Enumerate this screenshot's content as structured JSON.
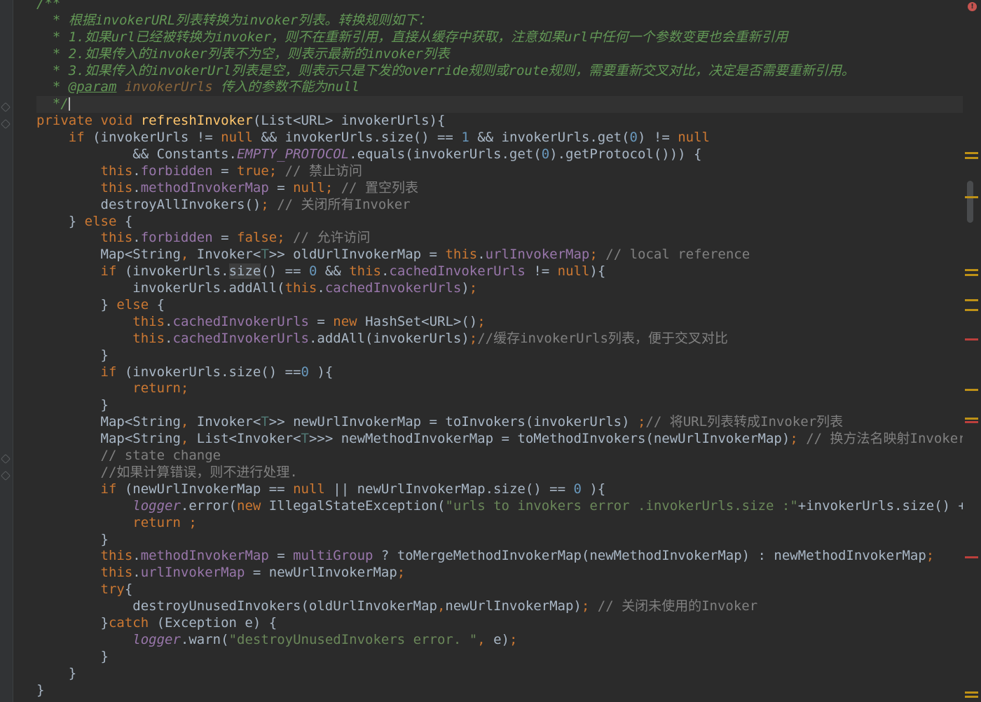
{
  "editor": {
    "status": {
      "error_indicator": "!"
    },
    "caret_line": 6,
    "lines": [
      [
        {
          "c": "t-doc",
          "t": "/**"
        }
      ],
      [
        {
          "c": "t-doc",
          "t": "  * 根据invokerURL列表转换为invoker列表。转换规则如下："
        }
      ],
      [
        {
          "c": "t-doc",
          "t": "  * 1.如果url已经被转换为invoker，则不在重新引用，直接从缓存中获取，注意如果url中任何一个参数变更也会重新引用"
        }
      ],
      [
        {
          "c": "t-doc",
          "t": "  * 2.如果传入的invoker列表不为空，则表示最新的invoker列表"
        }
      ],
      [
        {
          "c": "t-doc",
          "t": "  * 3.如果传入的invokerUrl列表是空，则表示只是下发的override规则或route规则，需要重新交叉对比，决定是否需要重新引用。"
        }
      ],
      [
        {
          "c": "t-doc",
          "t": "  * "
        },
        {
          "c": "t-tag",
          "t": "@param"
        },
        {
          "c": "t-doc",
          "t": " "
        },
        {
          "c": "t-docp",
          "t": "invokerUrls"
        },
        {
          "c": "t-doc",
          "t": " 传入的参数不能为null"
        }
      ],
      [
        {
          "c": "t-doc",
          "t": "  */"
        },
        {
          "c": "caret",
          "t": ""
        }
      ],
      [
        {
          "c": "t-kw",
          "t": "private void "
        },
        {
          "c": "t-fn",
          "t": "refreshInvoker"
        },
        {
          "t": "(List<URL> invokerUrls){"
        }
      ],
      [
        {
          "t": "    "
        },
        {
          "c": "t-kw",
          "t": "if"
        },
        {
          "t": " (invokerUrls != "
        },
        {
          "c": "t-kw",
          "t": "null"
        },
        {
          "t": " && invokerUrls.size() == "
        },
        {
          "c": "t-num",
          "t": "1"
        },
        {
          "t": " && invokerUrls.get("
        },
        {
          "c": "t-num",
          "t": "0"
        },
        {
          "t": ") != "
        },
        {
          "c": "t-kw",
          "t": "null"
        }
      ],
      [
        {
          "t": "            && Constants."
        },
        {
          "c": "t-sfld",
          "t": "EMPTY_PROTOCOL"
        },
        {
          "t": ".equals(invokerUrls.get("
        },
        {
          "c": "t-num",
          "t": "0"
        },
        {
          "t": ").getProtocol())) {"
        }
      ],
      [
        {
          "t": "        "
        },
        {
          "c": "t-kw",
          "t": "this"
        },
        {
          "t": "."
        },
        {
          "c": "t-fld",
          "t": "forbidden"
        },
        {
          "t": " = "
        },
        {
          "c": "t-kw",
          "t": "true;"
        },
        {
          "c": "t-cmt",
          "t": " // 禁止访问"
        }
      ],
      [
        {
          "t": "        "
        },
        {
          "c": "t-kw",
          "t": "this"
        },
        {
          "t": "."
        },
        {
          "c": "t-fld",
          "t": "methodInvokerMap"
        },
        {
          "t": " = "
        },
        {
          "c": "t-kw",
          "t": "null;"
        },
        {
          "c": "t-cmt",
          "t": " // 置空列表"
        }
      ],
      [
        {
          "t": "        destroyAllInvokers()"
        },
        {
          "c": "t-kw",
          "t": ";"
        },
        {
          "c": "t-cmt",
          "t": " // 关闭所有Invoker"
        }
      ],
      [
        {
          "t": "    } "
        },
        {
          "c": "t-kw",
          "t": "else"
        },
        {
          "t": " {"
        }
      ],
      [
        {
          "t": "        "
        },
        {
          "c": "t-kw",
          "t": "this"
        },
        {
          "t": "."
        },
        {
          "c": "t-fld",
          "t": "forbidden"
        },
        {
          "t": " = "
        },
        {
          "c": "t-kw",
          "t": "false;"
        },
        {
          "c": "t-cmt",
          "t": " // 允许访问"
        }
      ],
      [
        {
          "t": "        Map<String"
        },
        {
          "c": "t-kw",
          "t": ","
        },
        {
          "t": " Invoker<"
        },
        {
          "c": "t-type",
          "t": "T"
        },
        {
          "t": ">> oldUrlInvokerMap = "
        },
        {
          "c": "t-kw",
          "t": "this"
        },
        {
          "t": "."
        },
        {
          "c": "t-fld",
          "t": "urlInvokerMap"
        },
        {
          "c": "t-kw",
          "t": ";"
        },
        {
          "c": "t-cmt",
          "t": " // local reference"
        }
      ],
      [
        {
          "t": "        "
        },
        {
          "c": "t-kw",
          "t": "if"
        },
        {
          "t": " (invokerUrls."
        },
        {
          "c": "t-hl",
          "t": "size"
        },
        {
          "t": "() == "
        },
        {
          "c": "t-num",
          "t": "0"
        },
        {
          "t": " && "
        },
        {
          "c": "t-kw",
          "t": "this"
        },
        {
          "t": "."
        },
        {
          "c": "t-fld",
          "t": "cachedInvokerUrls"
        },
        {
          "t": " != "
        },
        {
          "c": "t-kw",
          "t": "null"
        },
        {
          "t": "){"
        }
      ],
      [
        {
          "t": "            invokerUrls.addAll("
        },
        {
          "c": "t-kw",
          "t": "this"
        },
        {
          "t": "."
        },
        {
          "c": "t-fld",
          "t": "cachedInvokerUrls"
        },
        {
          "t": ")"
        },
        {
          "c": "t-kw",
          "t": ";"
        }
      ],
      [
        {
          "t": "        } "
        },
        {
          "c": "t-kw",
          "t": "else"
        },
        {
          "t": " {"
        }
      ],
      [
        {
          "t": "            "
        },
        {
          "c": "t-kw",
          "t": "this"
        },
        {
          "t": "."
        },
        {
          "c": "t-fld",
          "t": "cachedInvokerUrls"
        },
        {
          "t": " = "
        },
        {
          "c": "t-kw",
          "t": "new"
        },
        {
          "t": " HashSet<URL>()"
        },
        {
          "c": "t-kw",
          "t": ";"
        }
      ],
      [
        {
          "t": "            "
        },
        {
          "c": "t-kw",
          "t": "this"
        },
        {
          "t": "."
        },
        {
          "c": "t-fld",
          "t": "cachedInvokerUrls"
        },
        {
          "t": ".addAll(invokerUrls)"
        },
        {
          "c": "t-kw",
          "t": ";"
        },
        {
          "c": "t-cmt",
          "t": "//缓存invokerUrls列表，便于交叉对比"
        }
      ],
      [
        {
          "t": "        }"
        }
      ],
      [
        {
          "t": "        "
        },
        {
          "c": "t-kw",
          "t": "if"
        },
        {
          "t": " (invokerUrls.size() =="
        },
        {
          "c": "t-num",
          "t": "0"
        },
        {
          "t": " ){"
        }
      ],
      [
        {
          "t": "            "
        },
        {
          "c": "t-kw",
          "t": "return;"
        }
      ],
      [
        {
          "t": "        }"
        }
      ],
      [
        {
          "t": "        Map<String"
        },
        {
          "c": "t-kw",
          "t": ","
        },
        {
          "t": " Invoker<"
        },
        {
          "c": "t-type",
          "t": "T"
        },
        {
          "t": ">> newUrlInvokerMap = toInvokers(invokerUrls) "
        },
        {
          "c": "t-kw",
          "t": ";"
        },
        {
          "c": "t-cmt",
          "t": "// 将URL列表转成Invoker列表"
        }
      ],
      [
        {
          "t": "        Map<String"
        },
        {
          "c": "t-kw",
          "t": ","
        },
        {
          "t": " List<Invoker<"
        },
        {
          "c": "t-type",
          "t": "T"
        },
        {
          "t": ">>> newMethodInvokerMap = toMethodInvokers(newUrlInvokerMap)"
        },
        {
          "c": "t-kw",
          "t": ";"
        },
        {
          "c": "t-cmt",
          "t": " // 换方法名映射Invoker列表"
        }
      ],
      [
        {
          "c": "t-cmt",
          "t": "        // state change"
        }
      ],
      [
        {
          "c": "t-cmt",
          "t": "        //如果计算错误，则不进行处理."
        }
      ],
      [
        {
          "t": "        "
        },
        {
          "c": "t-kw",
          "t": "if"
        },
        {
          "t": " (newUrlInvokerMap == "
        },
        {
          "c": "t-kw",
          "t": "null"
        },
        {
          "t": " || newUrlInvokerMap.size() == "
        },
        {
          "c": "t-num",
          "t": "0"
        },
        {
          "t": " ){"
        }
      ],
      [
        {
          "t": "            "
        },
        {
          "c": "t-log",
          "t": "logger"
        },
        {
          "t": ".error("
        },
        {
          "c": "t-kw",
          "t": "new"
        },
        {
          "t": " IllegalStateException("
        },
        {
          "c": "t-str",
          "t": "\"urls to invokers error .invokerUrls.size :\""
        },
        {
          "t": "+invokerUrls.size() + "
        },
        {
          "c": "t-str",
          "t": "\","
        }
      ],
      [
        {
          "t": "            "
        },
        {
          "c": "t-kw",
          "t": "return ;"
        }
      ],
      [
        {
          "t": "        }"
        }
      ],
      [
        {
          "t": "        "
        },
        {
          "c": "t-kw",
          "t": "this"
        },
        {
          "t": "."
        },
        {
          "c": "t-fld",
          "t": "methodInvokerMap"
        },
        {
          "t": " = "
        },
        {
          "c": "t-fld",
          "t": "multiGroup"
        },
        {
          "t": " ? toMergeMethodInvokerMap(newMethodInvokerMap) : newMethodInvokerMap"
        },
        {
          "c": "t-kw",
          "t": ";"
        }
      ],
      [
        {
          "t": "        "
        },
        {
          "c": "t-kw",
          "t": "this"
        },
        {
          "t": "."
        },
        {
          "c": "t-fld",
          "t": "urlInvokerMap"
        },
        {
          "t": " = newUrlInvokerMap"
        },
        {
          "c": "t-kw",
          "t": ";"
        }
      ],
      [
        {
          "t": "        "
        },
        {
          "c": "t-kw",
          "t": "try"
        },
        {
          "t": "{"
        }
      ],
      [
        {
          "t": "            destroyUnusedInvokers(oldUrlInvokerMap"
        },
        {
          "c": "t-kw",
          "t": ","
        },
        {
          "t": "newUrlInvokerMap)"
        },
        {
          "c": "t-kw",
          "t": ";"
        },
        {
          "c": "t-cmt",
          "t": " // 关闭未使用的Invoker"
        }
      ],
      [
        {
          "t": "        }"
        },
        {
          "c": "t-kw",
          "t": "catch"
        },
        {
          "t": " (Exception e) {"
        }
      ],
      [
        {
          "t": "            "
        },
        {
          "c": "t-log",
          "t": "logger"
        },
        {
          "t": ".warn("
        },
        {
          "c": "t-str",
          "t": "\"destroyUnusedInvokers error. \""
        },
        {
          "c": "t-kw",
          "t": ","
        },
        {
          "t": " e)"
        },
        {
          "c": "t-kw",
          "t": ";"
        }
      ],
      [
        {
          "t": "        }"
        }
      ],
      [
        {
          "t": "    }"
        }
      ],
      [
        {
          "t": "}"
        }
      ]
    ]
  }
}
